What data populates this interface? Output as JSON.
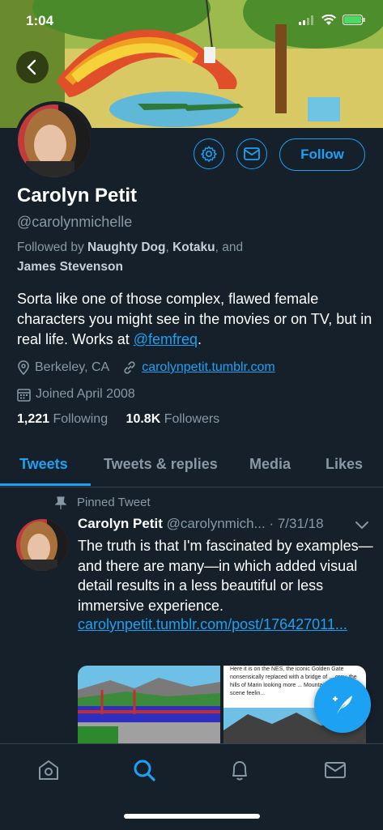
{
  "status_bar": {
    "time": "1:04"
  },
  "profile": {
    "name": "Carolyn Petit",
    "handle": "@carolynmichelle",
    "followed_by_prefix": "Followed by",
    "followed_by_1": "Naughty Dog",
    "followed_by_2": "Kotaku",
    "followed_by_and": ", and",
    "followed_by_3": "James Stevenson",
    "bio_text": "Sorta like one of those complex, flawed female characters you might see in the movies or on TV, but in real life. Works at",
    "bio_link": "@femfreq",
    "bio_end": ".",
    "location": "Berkeley, CA",
    "website": "carolynpetit.tumblr.com",
    "joined": "Joined April 2008",
    "following_count": "1,221",
    "following_label": "Following",
    "followers_count": "10.8K",
    "followers_label": "Followers",
    "follow_label": "Follow"
  },
  "tabs": [
    "Tweets",
    "Tweets & replies",
    "Media",
    "Likes"
  ],
  "tweet": {
    "pinned_label": "Pinned Tweet",
    "author": "Carolyn Petit",
    "handle_date": "@carolynmich... · 7/31/18",
    "text": "The truth is that I'm fascinated by examples—and there are many—in which added visual detail results in a less beautiful or less immersive experience.",
    "link": "carolynpetit.tumblr.com/post/176427011...",
    "media_caption": "Here it is on the NES, the iconic Golden Gate nonsensically replaced with a bridge of ... gray, the hills of Marin looking more ... Mountains, the whole scene feelin..."
  },
  "colors": {
    "accent": "#1da1f2",
    "background": "#15202b",
    "secondary_text": "#8899a6"
  },
  "icons": {
    "back": "chevron-left-icon",
    "settings": "gear-icon",
    "message": "envelope-icon",
    "location": "location-pin-icon",
    "link": "link-icon",
    "calendar": "calendar-icon",
    "pin": "pin-icon",
    "compose": "compose-tweet-icon",
    "nav": [
      "home-icon",
      "search-icon",
      "bell-icon",
      "envelope-icon"
    ]
  }
}
